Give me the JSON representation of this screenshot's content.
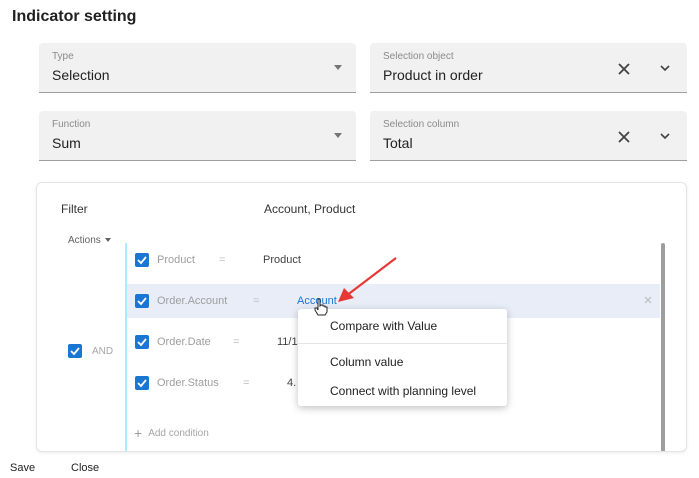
{
  "header": {
    "title": "Indicator setting"
  },
  "fields": {
    "type": {
      "label": "Type",
      "value": "Selection"
    },
    "selection_object": {
      "label": "Selection object",
      "value": "Product in order"
    },
    "function": {
      "label": "Function",
      "value": "Sum"
    },
    "selection_column": {
      "label": "Selection column",
      "value": "Total"
    }
  },
  "filter": {
    "label": "Filter",
    "summary": "Account, Product",
    "actions_label": "Actions",
    "and_label": "AND",
    "add_condition": "Add condition",
    "conditions": [
      {
        "column": "Product",
        "operator": "=",
        "value": "Product",
        "checked": true
      },
      {
        "column": "Order.Account",
        "operator": "=",
        "value": "Account",
        "checked": true
      },
      {
        "column": "Order.Date",
        "operator": "=",
        "value": "11/1",
        "checked": true
      },
      {
        "column": "Order.Status",
        "operator": "=",
        "value": "4.",
        "checked": true
      }
    ]
  },
  "context_menu": {
    "items": [
      "Compare with Value",
      "Column value",
      "Connect with planning level"
    ]
  },
  "footer": {
    "save_label": "Save",
    "close_label": "Close"
  },
  "colors": {
    "accent": "#1976d2",
    "arrow": "#e53935",
    "highlight": "#e8edf8"
  }
}
